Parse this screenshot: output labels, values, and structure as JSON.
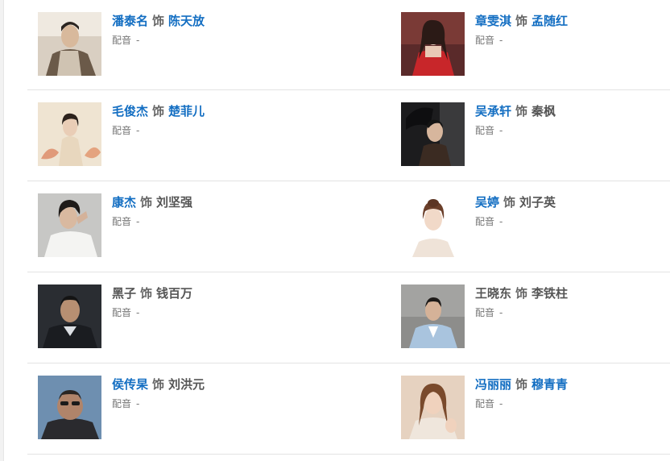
{
  "cast": [
    {
      "left": {
        "actor": "潘泰名",
        "as": "饰",
        "role": "陈天放",
        "actor_link": true,
        "role_link": true,
        "voice_label": "配音",
        "voice_value": "-",
        "photo": "actor-portrait-photo"
      },
      "right": {
        "actor": "章雯淇",
        "as": "饰",
        "role": "孟随红",
        "actor_link": true,
        "role_link": true,
        "voice_label": "配音",
        "voice_value": "-",
        "photo": "actress-red-dress-photo"
      }
    },
    {
      "left": {
        "actor": "毛俊杰",
        "as": "饰",
        "role": "楚菲儿",
        "actor_link": true,
        "role_link": true,
        "voice_label": "配音",
        "voice_value": "-",
        "photo": "actress-flowers-photo"
      },
      "right": {
        "actor": "吴承轩",
        "as": "饰",
        "role": "秦枫",
        "actor_link": true,
        "role_link": false,
        "voice_label": "配音",
        "voice_value": "-",
        "photo": "actor-hat-photo"
      }
    },
    {
      "left": {
        "actor": "康杰",
        "as": "饰",
        "role": "刘坚强",
        "actor_link": true,
        "role_link": false,
        "voice_label": "配音",
        "voice_value": "-",
        "photo": "actor-white-shirt-photo"
      },
      "right": {
        "actor": "吴婷",
        "as": "饰",
        "role": "刘子英",
        "actor_link": true,
        "role_link": false,
        "voice_label": "配音",
        "voice_value": "-",
        "photo": "actress-portrait-photo"
      }
    },
    {
      "left": {
        "actor": "黑子",
        "as": "饰",
        "role": "钱百万",
        "actor_link": false,
        "role_link": false,
        "voice_label": "配音",
        "voice_value": "-",
        "photo": "actor-suit-photo"
      },
      "right": {
        "actor": "王晓东",
        "as": "饰",
        "role": "李铁柱",
        "actor_link": false,
        "role_link": false,
        "voice_label": "配音",
        "voice_value": "-",
        "photo": "actor-light-suit-photo"
      }
    },
    {
      "left": {
        "actor": "侯传杲",
        "as": "饰",
        "role": "刘洪元",
        "actor_link": true,
        "role_link": false,
        "voice_label": "配音",
        "voice_value": "-",
        "photo": "actor-glasses-photo"
      },
      "right": {
        "actor": "冯丽丽",
        "as": "饰",
        "role": "穆青青",
        "actor_link": true,
        "role_link": true,
        "voice_label": "配音",
        "voice_value": "-",
        "photo": "actress-selfie-photo"
      }
    }
  ],
  "colors": {
    "link": "#136ec2",
    "plain": "#555555",
    "divider": "#e3e3e3"
  }
}
